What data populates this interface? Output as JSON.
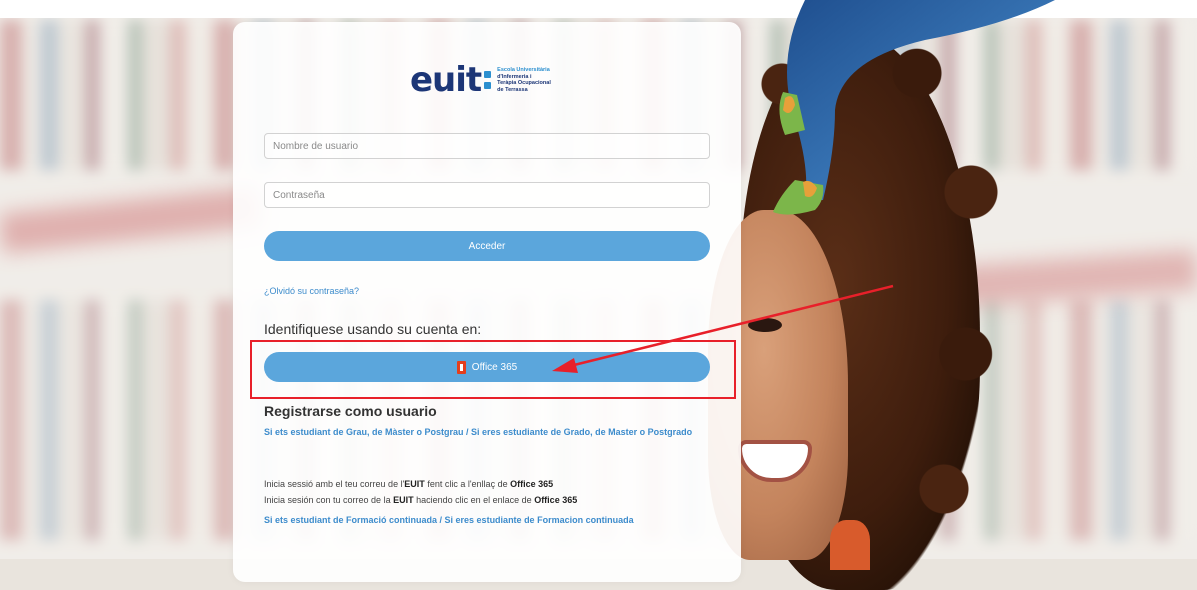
{
  "logo": {
    "wordmark": "euit",
    "subtitle": [
      "Escola Universitària",
      "d'Infermeria i",
      "Teràpia Ocupacional",
      "de Terrassa"
    ]
  },
  "form": {
    "username_placeholder": "Nombre de usuario",
    "password_placeholder": "Contraseña",
    "submit_label": "Acceder",
    "forgot_password": "¿Olvidó su contraseña?"
  },
  "sso": {
    "heading": "Identifiquese usando su cuenta en:",
    "office_label": "Office 365",
    "office_icon": "office-logo-icon"
  },
  "register": {
    "title": "Registrarse como usuario",
    "link_grado": "Si ets estudiant de Grau, de Màster o Postgrau  / Si eres estudiante de Grado, de Master o Postgrado",
    "info_ca_pre": "Inicia sessió amb el teu correu de l'",
    "info_ca_bold1": "EUIT",
    "info_ca_mid": " fent clic a l'enllaç de ",
    "info_ca_bold2": "Office 365",
    "info_es_pre": "Inicia sesión con tu correo de la ",
    "info_es_bold1": "EUIT",
    "info_es_mid": " haciendo clic en el enlace de ",
    "info_es_bold2": "Office 365",
    "link_formacio": "Si ets estudiant de Formació continuada / Si eres estudiante de Formacion continuada"
  },
  "colors": {
    "button_blue": "#5ba6dc",
    "link_blue": "#3d8ccc",
    "highlight_red": "#e8202a",
    "logo_navy": "#1c3677"
  }
}
